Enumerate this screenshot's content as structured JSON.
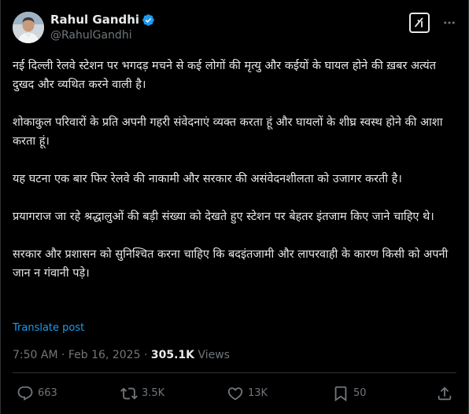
{
  "author": {
    "display_name": "Rahul Gandhi",
    "handle": "@RahulGandhi",
    "verified": true
  },
  "post": {
    "paragraphs": [
      "नई दिल्ली रेलवे स्टेशन पर भगदड़ मचने से कई लोगों की मृत्यु और कईयों के घायल होने की ख़बर अत्यंत दुखद और व्यथित करने वाली है।",
      "शोकाकुल परिवारों के प्रति अपनी गहरी संवेदनाएं व्यक्त करता हूं और घायलों के शीघ्र स्वस्थ होने की आशा करता हूं।",
      "यह घटना एक बार फिर रेलवे की नाकामी और सरकार की असंवेदनशीलता को उजागर करती है।",
      "प्रयागराज जा रहे श्रद्धालुओं की बड़ी संख्या को देखते हुए स्टेशन पर बेहतर इंतजाम किए जाने चाहिए थे।",
      "सरकार और प्रशासन को सुनिश्चित करना चाहिए कि बदइंतजामी और लापरवाही के कारण किसी को अपनी जान न गंवानी पड़े।"
    ],
    "translate_label": "Translate post"
  },
  "meta": {
    "time": "7:50 AM",
    "separator": "·",
    "date": "Feb 16, 2025",
    "views_count": "305.1K",
    "views_label": "Views"
  },
  "actions": {
    "replies": "663",
    "reposts": "3.5K",
    "likes": "13K",
    "bookmarks": "50"
  },
  "icons": {
    "verified": "verified-badge-icon",
    "grok": "grok-icon",
    "more": "more-horizontal-icon",
    "reply": "reply-icon",
    "repost": "repost-icon",
    "like": "heart-icon",
    "bookmark": "bookmark-icon",
    "share": "share-icon"
  },
  "colors": {
    "background": "#000000",
    "text": "#e7e9ea",
    "secondary": "#71767b",
    "link": "#1d9bf0",
    "verified": "#1d9bf0",
    "divider": "#2f3336"
  }
}
